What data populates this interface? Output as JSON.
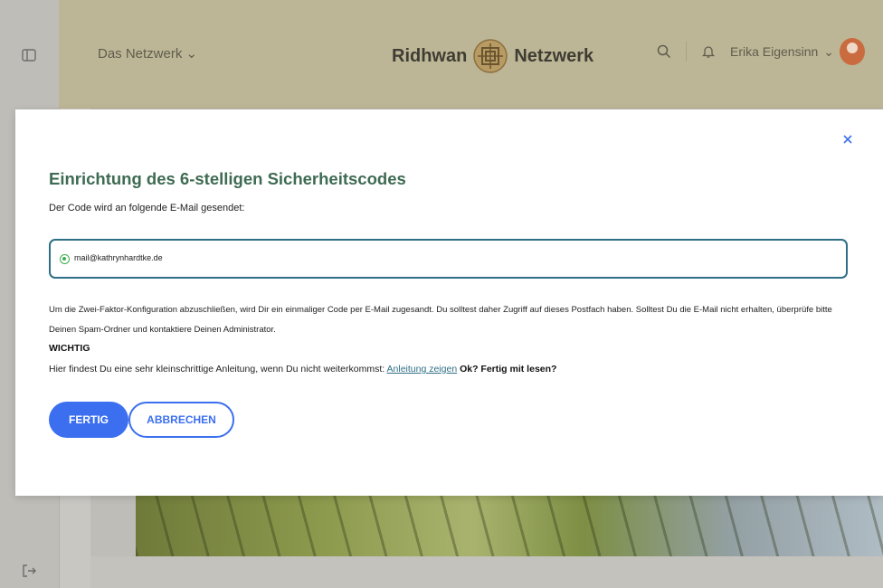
{
  "header": {
    "nav_label": "Das Netzwerk",
    "brand_left": "Ridhwan",
    "brand_right": "Netzwerk",
    "user_name": "Erika Eigensinn",
    "icons": [
      "sidebar-toggle-icon",
      "chevron-down-icon",
      "search-icon",
      "bell-icon",
      "logout-icon"
    ]
  },
  "modal": {
    "title": "Einrichtung des 6-stelligen Sicherheitscodes",
    "subtitle": "Der Code wird an folgende E-Mail gesendet:",
    "email": "mail@kathrynhardtke.de",
    "description": "Um die Zwei-Faktor-Konfiguration abzuschließen, wird Dir ein einmaliger Code per E-Mail zugesandt. Du solltest daher Zugriff auf dieses Postfach haben. Solltest Du die E-Mail nicht erhalten, überprüfe bitte Deinen Spam-Ordner und kontaktiere Deinen Administrator.",
    "important_label": "WICHTIG",
    "hint_text": "Hier findest Du eine sehr kleinschrittige Anleitung, wenn Du nicht weiterkommst:",
    "hint_link": "Anleitung zeigen",
    "hint_suffix": "Ok? Fertig mit lesen?",
    "confirm_label": "FERTIG",
    "cancel_label": "ABBRECHEN"
  },
  "colors": {
    "title_green": "#3e6b52",
    "primary_blue": "#3b6ff0",
    "input_border": "#2e6f85",
    "radio_green": "#3fae4f"
  }
}
